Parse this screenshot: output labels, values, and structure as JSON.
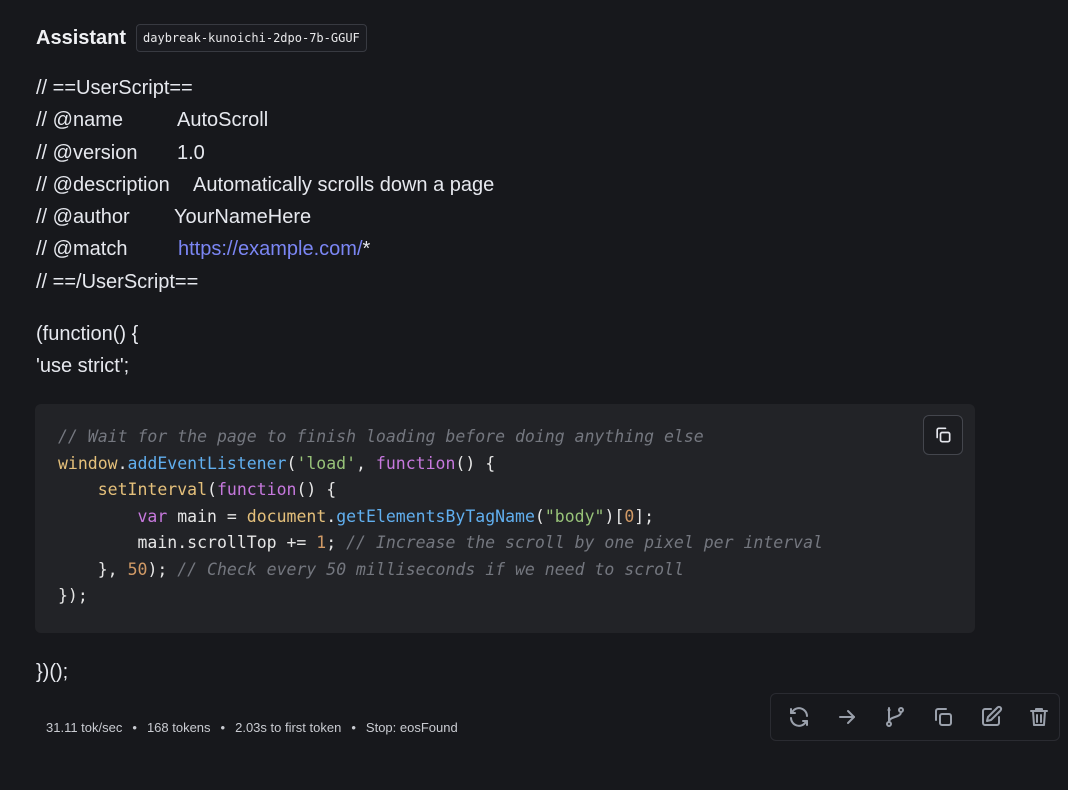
{
  "message": {
    "role": "Assistant",
    "model": "daybreak-kunoichi-2dpo-7b-GGUF"
  },
  "userscript": {
    "open": "// ==UserScript==",
    "name_key": "// @name",
    "name_val": "AutoScroll",
    "version_key": "// @version",
    "version_val": "1.0",
    "desc_key": "// @description",
    "desc_val": "Automatically scrolls down a page",
    "author_key": "// @author",
    "author_val": "YourNameHere",
    "match_key": "// @match",
    "match_link": "https://example.com/",
    "match_suffix": "*",
    "close": "// ==/UserScript=="
  },
  "prelude": {
    "line1": "(function() {",
    "line2": "'use strict';"
  },
  "code": {
    "l1_comment": "// Wait for the page to finish loading before doing anything else",
    "l2_obj": "window",
    "l2_dot": ".",
    "l2_fn": "addEventListener",
    "l2_p1": "(",
    "l2_str": "'load'",
    "l2_p2": ", ",
    "l2_kw": "function",
    "l2_p3": "() {",
    "l3_indent": "    ",
    "l3_fn": "setInterval",
    "l3_p1": "(",
    "l3_kw": "function",
    "l3_p2": "() {",
    "l4_indent": "        ",
    "l4_kw": "var",
    "l4_p1": " main = ",
    "l4_obj": "document",
    "l4_dot": ".",
    "l4_fn": "getElementsByTagName",
    "l4_p2": "(",
    "l4_str": "\"body\"",
    "l4_p3": ")[",
    "l4_num": "0",
    "l4_p4": "];",
    "l5_indent": "        ",
    "l5_p1": "main.scrollTop += ",
    "l5_num": "1",
    "l5_p2": "; ",
    "l5_comment": "// Increase the scroll by one pixel per interval",
    "l6_indent": "    ",
    "l6_p1": "}, ",
    "l6_num": "50",
    "l6_p2": "); ",
    "l6_comment": "// Check every 50 milliseconds if we need to scroll",
    "l7": "});"
  },
  "postlude": "})();",
  "stats": {
    "speed": "31.11 tok/sec",
    "tokens": "168 tokens",
    "first_token": "2.03s to first token",
    "stop": "Stop: eosFound",
    "separator": "•"
  },
  "icons": {
    "copy": "copy-icon",
    "regenerate": "regenerate-icon",
    "continue": "arrow-right-icon",
    "branch": "branch-icon",
    "duplicate": "copy-icon",
    "edit": "edit-icon",
    "delete": "trash-icon"
  },
  "colors": {
    "background": "#17181c",
    "code_bg": "#222327",
    "link": "#7b86f4"
  }
}
